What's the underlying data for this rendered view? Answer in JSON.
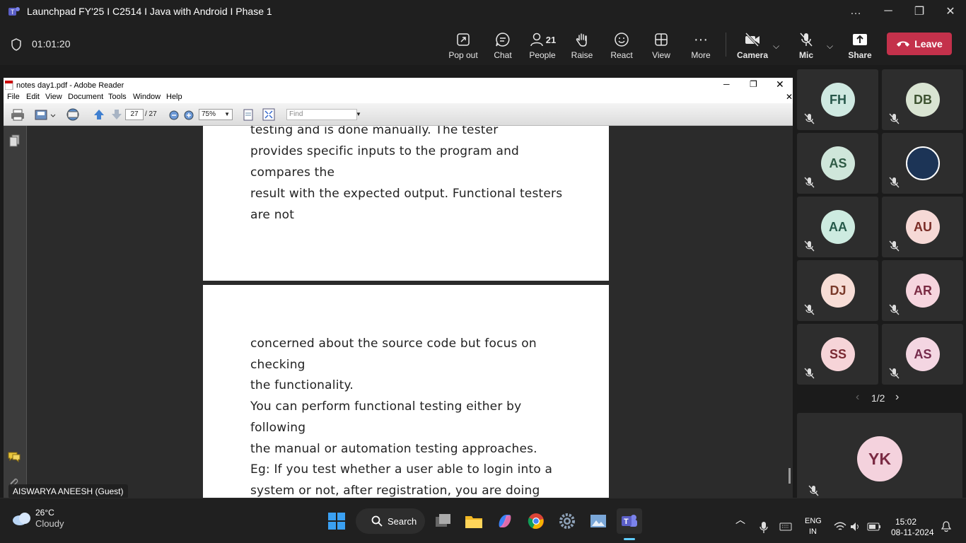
{
  "window": {
    "title": "Launchpad FY'25 I C2514 I Java with Android I Phase 1",
    "controls": [
      "…",
      "─",
      "❐",
      "✕"
    ]
  },
  "meeting": {
    "timer": "01:01:20",
    "toolbar": {
      "popout": "Pop out",
      "chat": "Chat",
      "people": "People",
      "people_count": "21",
      "raise": "Raise",
      "react": "React",
      "view": "View",
      "more": "More",
      "camera": "Camera",
      "mic": "Mic",
      "share": "Share",
      "leave": "Leave"
    }
  },
  "reader": {
    "title": "notes day1.pdf - Adobe Reader",
    "menu": [
      "File",
      "Edit",
      "View",
      "Document",
      "Tools",
      "Window",
      "Help"
    ],
    "page_current": "27",
    "page_total": "/ 27",
    "zoom": "75%",
    "find_placeholder": "Find",
    "page1_lines": [
      "testing and is done manually. The tester",
      "provides specific inputs to the program and",
      "compares the",
      "result with the expected output. Functional testers",
      "are not"
    ],
    "page2_lines": [
      "concerned about the source code but focus on",
      "checking",
      "the functionality.",
      "You can perform functional testing either by",
      "following",
      "the manual or automation testing approaches.",
      "Eg: If you test whether a user able to login into a",
      "system or not, after registration, you are doing"
    ]
  },
  "presenter_label": "AISWARYA ANEESH (Guest)",
  "participants": [
    {
      "initials": "FH",
      "bg": "#cfe9e1",
      "fg": "#27574a"
    },
    {
      "initials": "DB",
      "bg": "#d9e4d2",
      "fg": "#3d5230"
    },
    {
      "initials": "AS",
      "bg": "#cfe6da",
      "fg": "#2f5a45"
    },
    {
      "initials": "",
      "bg": "#1c3456",
      "fg": "#ffffff"
    },
    {
      "initials": "AA",
      "bg": "#cdebe0",
      "fg": "#26594a"
    },
    {
      "initials": "AU",
      "bg": "#f6d9d6",
      "fg": "#7a2d27"
    },
    {
      "initials": "DJ",
      "bg": "#f7ddd6",
      "fg": "#7a3a2a"
    },
    {
      "initials": "AR",
      "bg": "#f6d5de",
      "fg": "#7a2b43"
    },
    {
      "initials": "SS",
      "bg": "#f6d4d8",
      "fg": "#7a2a33"
    },
    {
      "initials": "AS",
      "bg": "#f4d6e2",
      "fg": "#742a4b"
    }
  ],
  "pagination": "1/2",
  "self_tile": {
    "initials": "YK",
    "bg": "#f4d2dd",
    "fg": "#7a2a43"
  },
  "taskbar": {
    "weather_temp": "26°C",
    "weather_desc": "Cloudy",
    "search": "Search",
    "lang_top": "ENG",
    "lang_bottom": "IN",
    "time": "15:02",
    "date": "08-11-2024"
  }
}
